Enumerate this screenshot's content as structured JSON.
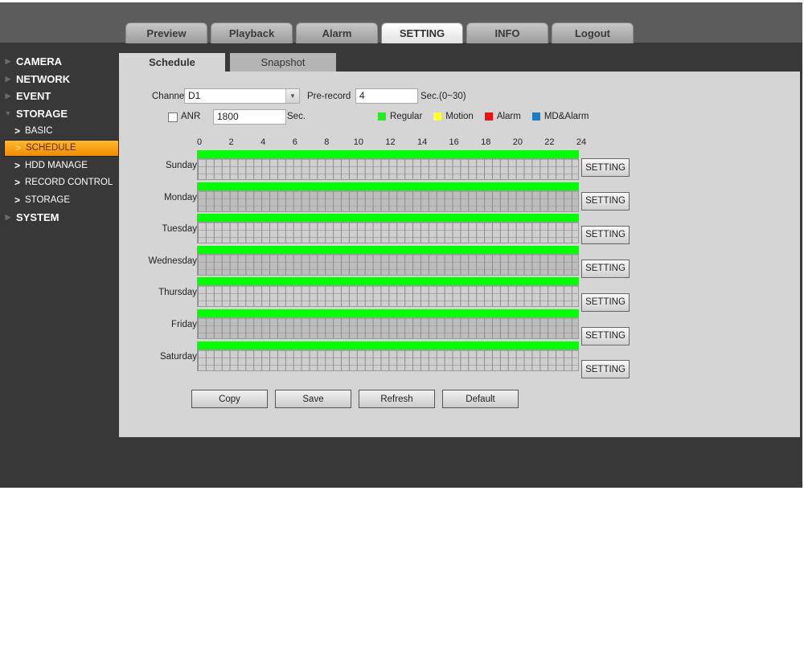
{
  "main_tabs": [
    {
      "label": "Preview",
      "active": false
    },
    {
      "label": "Playback",
      "active": false
    },
    {
      "label": "Alarm",
      "active": false
    },
    {
      "label": "SETTING",
      "active": true
    },
    {
      "label": "INFO",
      "active": false
    },
    {
      "label": "Logout",
      "active": false
    }
  ],
  "sidebar": {
    "camera": "CAMERA",
    "network": "NETWORK",
    "event": "EVENT",
    "storage": "STORAGE",
    "storage_items": [
      {
        "label": "BASIC",
        "active": false
      },
      {
        "label": "SCHEDULE",
        "active": true
      },
      {
        "label": "HDD MANAGE",
        "active": false
      },
      {
        "label": "RECORD CONTROL",
        "active": false
      },
      {
        "label": "STORAGE",
        "active": false
      }
    ],
    "system": "SYSTEM"
  },
  "sub_tabs": [
    {
      "label": "Schedule",
      "active": true
    },
    {
      "label": "Snapshot",
      "active": false
    }
  ],
  "form": {
    "channel_label": "Channel",
    "channel_value": "D1",
    "prerecord_label": "Pre-record",
    "prerecord_value": "4",
    "prerecord_unit": "Sec.(0~30)",
    "anr_label": "ANR",
    "anr_checked": false,
    "anr_value": "1800",
    "anr_unit": "Sec."
  },
  "legend": [
    {
      "label": "Regular",
      "color": "#22ee22"
    },
    {
      "label": "Motion",
      "color": "#ffff33"
    },
    {
      "label": "Alarm",
      "color": "#ee1111"
    },
    {
      "label": "MD&Alarm",
      "color": "#1a7cc4"
    }
  ],
  "hours": [
    "0",
    "2",
    "4",
    "6",
    "8",
    "10",
    "12",
    "14",
    "16",
    "18",
    "20",
    "22",
    "24"
  ],
  "days": [
    {
      "label": "Sunday",
      "regular": "0-24"
    },
    {
      "label": "Monday",
      "regular": "0-24"
    },
    {
      "label": "Tuesday",
      "regular": "0-24"
    },
    {
      "label": "Wednesday",
      "regular": "0-24"
    },
    {
      "label": "Thursday",
      "regular": "0-24"
    },
    {
      "label": "Friday",
      "regular": "0-24"
    },
    {
      "label": "Saturday",
      "regular": "0-24"
    }
  ],
  "setting_label": "SETTING",
  "actions": {
    "copy": "Copy",
    "save": "Save",
    "refresh": "Refresh",
    "default": "Default"
  }
}
